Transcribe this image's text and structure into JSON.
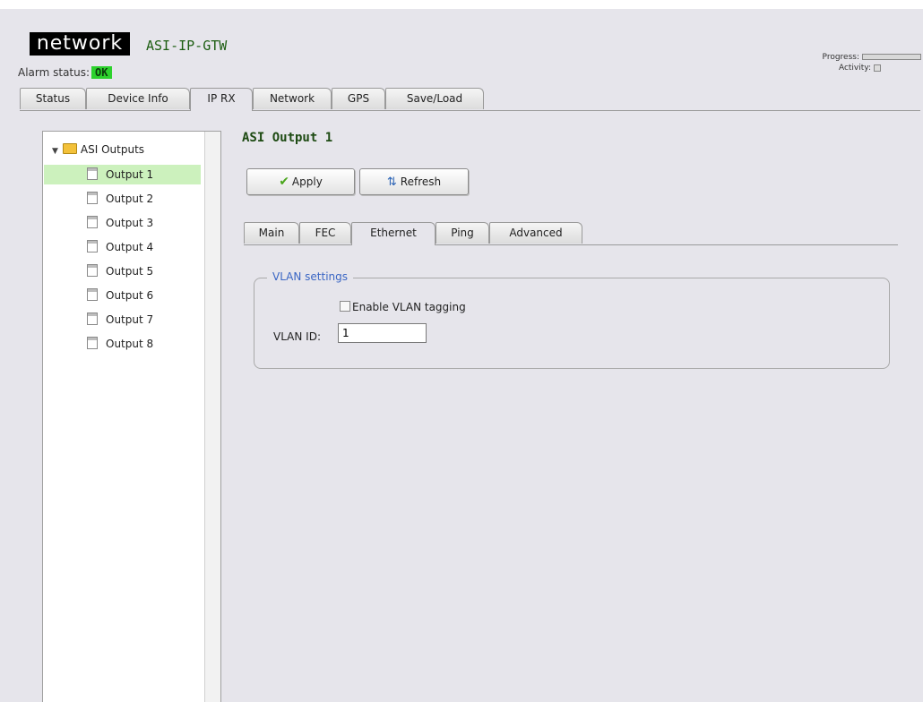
{
  "header": {
    "logo_text": "network",
    "device_name": "ASI-IP-GTW",
    "alarm_label": "Alarm status:",
    "alarm_value": "OK",
    "alarm_color": "#2dd22d",
    "progress_label": "Progress:",
    "activity_label": "Activity:"
  },
  "main_tabs": [
    "Status",
    "Device Info",
    "IP RX",
    "Network",
    "GPS",
    "Save/Load"
  ],
  "active_main_tab": "IP RX",
  "tree": {
    "root_label": "ASI Outputs",
    "items": [
      "Output 1",
      "Output 2",
      "Output 3",
      "Output 4",
      "Output 5",
      "Output 6",
      "Output 7",
      "Output 8"
    ],
    "selected": "Output 1"
  },
  "content": {
    "title": "ASI Output 1",
    "apply_label": "Apply",
    "refresh_label": "Refresh"
  },
  "sub_tabs": [
    "Main",
    "FEC",
    "Ethernet",
    "Ping",
    "Advanced"
  ],
  "active_sub_tab": "Ethernet",
  "vlan": {
    "legend": "VLAN settings",
    "enable_label": "Enable VLAN tagging",
    "enable_checked": false,
    "id_label": "VLAN ID:",
    "id_value": "1"
  }
}
